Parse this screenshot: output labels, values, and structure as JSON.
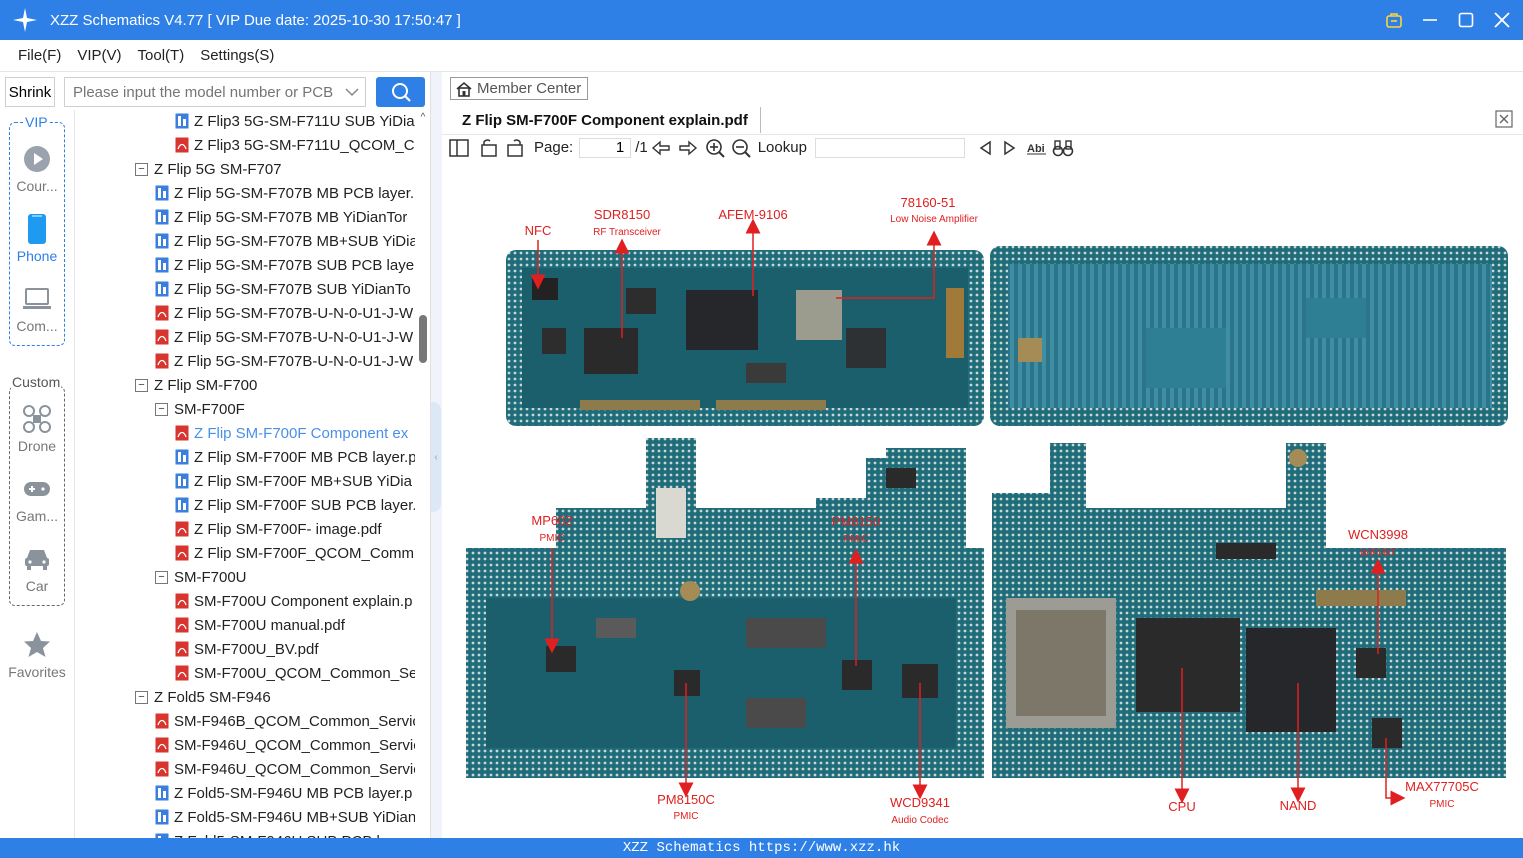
{
  "window": {
    "title": "XZZ Schematics V4.77 [ VIP Due date: 2025-10-30 17:50:47 ]"
  },
  "menu": [
    "File(F)",
    "VIP(V)",
    "Tool(T)",
    "Settings(S)"
  ],
  "left_toolbar": {
    "shrink_label": "Shrink",
    "search_placeholder": "Please input the model number or PCB"
  },
  "rail": {
    "vip_label": "VIP",
    "custom_label": "Custom",
    "items": [
      {
        "label": "Cour...",
        "icon": "play-circle-icon"
      },
      {
        "label": "Phone",
        "icon": "phone-icon"
      },
      {
        "label": "Com...",
        "icon": "laptop-icon"
      },
      {
        "label": "Drone",
        "icon": "drone-icon"
      },
      {
        "label": "Gam...",
        "icon": "gamepad-icon"
      },
      {
        "label": "Car",
        "icon": "car-icon"
      },
      {
        "label": "Favorites",
        "icon": "star-icon"
      }
    ]
  },
  "tree": [
    {
      "text": "Z Flip3 5G-SM-F711U SUB YiDia",
      "level": 3,
      "kind": "pcb"
    },
    {
      "text": "Z Flip3 5G-SM-F711U_QCOM_Co",
      "level": 3,
      "kind": "pdf"
    },
    {
      "text": "Z Flip 5G SM-F707",
      "level": 1,
      "kind": "folder"
    },
    {
      "text": "Z Flip 5G-SM-F707B MB PCB layer.",
      "level": 2,
      "kind": "pcb"
    },
    {
      "text": "Z Flip 5G-SM-F707B MB YiDianTor",
      "level": 2,
      "kind": "pcb"
    },
    {
      "text": "Z Flip 5G-SM-F707B MB+SUB YiDia",
      "level": 2,
      "kind": "pcb"
    },
    {
      "text": "Z Flip 5G-SM-F707B SUB PCB layer",
      "level": 2,
      "kind": "pcb"
    },
    {
      "text": "Z Flip 5G-SM-F707B SUB YiDianTo",
      "level": 2,
      "kind": "pcb"
    },
    {
      "text": "Z Flip 5G-SM-F707B-U-N-0-U1-J-W",
      "level": 2,
      "kind": "pdf"
    },
    {
      "text": "Z Flip 5G-SM-F707B-U-N-0-U1-J-W",
      "level": 2,
      "kind": "pdf"
    },
    {
      "text": "Z Flip 5G-SM-F707B-U-N-0-U1-J-W",
      "level": 2,
      "kind": "pdf"
    },
    {
      "text": "Z Flip SM-F700",
      "level": 1,
      "kind": "folder"
    },
    {
      "text": "SM-F700F",
      "level": 2,
      "kind": "folder"
    },
    {
      "text": "Z Flip SM-F700F Component ex",
      "level": 3,
      "kind": "pdf",
      "selected": true
    },
    {
      "text": "Z Flip SM-F700F MB PCB layer.p",
      "level": 3,
      "kind": "pcb"
    },
    {
      "text": "Z Flip SM-F700F MB+SUB YiDia",
      "level": 3,
      "kind": "pcb"
    },
    {
      "text": "Z Flip SM-F700F SUB PCB layer.p",
      "level": 3,
      "kind": "pcb"
    },
    {
      "text": "Z Flip SM-F700F- image.pdf",
      "level": 3,
      "kind": "pdf"
    },
    {
      "text": "Z Flip SM-F700F_QCOM_Comm",
      "level": 3,
      "kind": "pdf"
    },
    {
      "text": "SM-F700U",
      "level": 2,
      "kind": "folder"
    },
    {
      "text": "SM-F700U Component explain.p",
      "level": 3,
      "kind": "pdf"
    },
    {
      "text": "SM-F700U manual.pdf",
      "level": 3,
      "kind": "pdf"
    },
    {
      "text": "SM-F700U_BV.pdf",
      "level": 3,
      "kind": "pdf"
    },
    {
      "text": "SM-F700U_QCOM_Common_Se",
      "level": 3,
      "kind": "pdf"
    },
    {
      "text": "Z Fold5 SM-F946",
      "level": 1,
      "kind": "folder"
    },
    {
      "text": "SM-F946B_QCOM_Common_Servic",
      "level": 2,
      "kind": "pdf"
    },
    {
      "text": "SM-F946U_QCOM_Common_Servic",
      "level": 2,
      "kind": "pdf"
    },
    {
      "text": "SM-F946U_QCOM_Common_Servic",
      "level": 2,
      "kind": "pdf"
    },
    {
      "text": "Z Fold5-SM-F946U MB PCB layer.p",
      "level": 2,
      "kind": "pcb"
    },
    {
      "text": "Z Fold5-SM-F946U MB+SUB YiDian",
      "level": 2,
      "kind": "pcb"
    },
    {
      "text": "Z Fold5-SM-F946U SUB PCB la",
      "level": 2,
      "kind": "pcb"
    }
  ],
  "viewer": {
    "member_center": "Member Center",
    "tab_title": "Z Flip SM-F700F Component explain.pdf",
    "page_label": "Page:",
    "page_value": "1",
    "page_total": "/1",
    "lookup_label": "Lookup"
  },
  "annotations": {
    "nfc": "NFC",
    "sdr": "SDR8150",
    "sdr_sub": "RF Transceiver",
    "afem": "AFEM-9106",
    "lna": "78160-51",
    "lna_sub": "Low Noise Amplifier",
    "mp602": "MP602",
    "mp602_sub": "PMIC",
    "pm8150": "PM8150",
    "pm8150_sub": "PMIC",
    "wcn": "WCN3998",
    "wcn_sub": "WIFI/BT",
    "pm8150c": "PM8150C",
    "pm8150c_sub": "PMIC",
    "wcd": "WCD9341",
    "wcd_sub": "Audio Codec",
    "cpu": "CPU",
    "nand": "NAND",
    "max": "MAX77705C",
    "max_sub": "PMIC"
  },
  "status": "XZZ Schematics https://www.xzz.hk",
  "colors": {
    "accent": "#2f80e6",
    "annotation": "#e02020",
    "pcb": "#1d6a7a"
  }
}
